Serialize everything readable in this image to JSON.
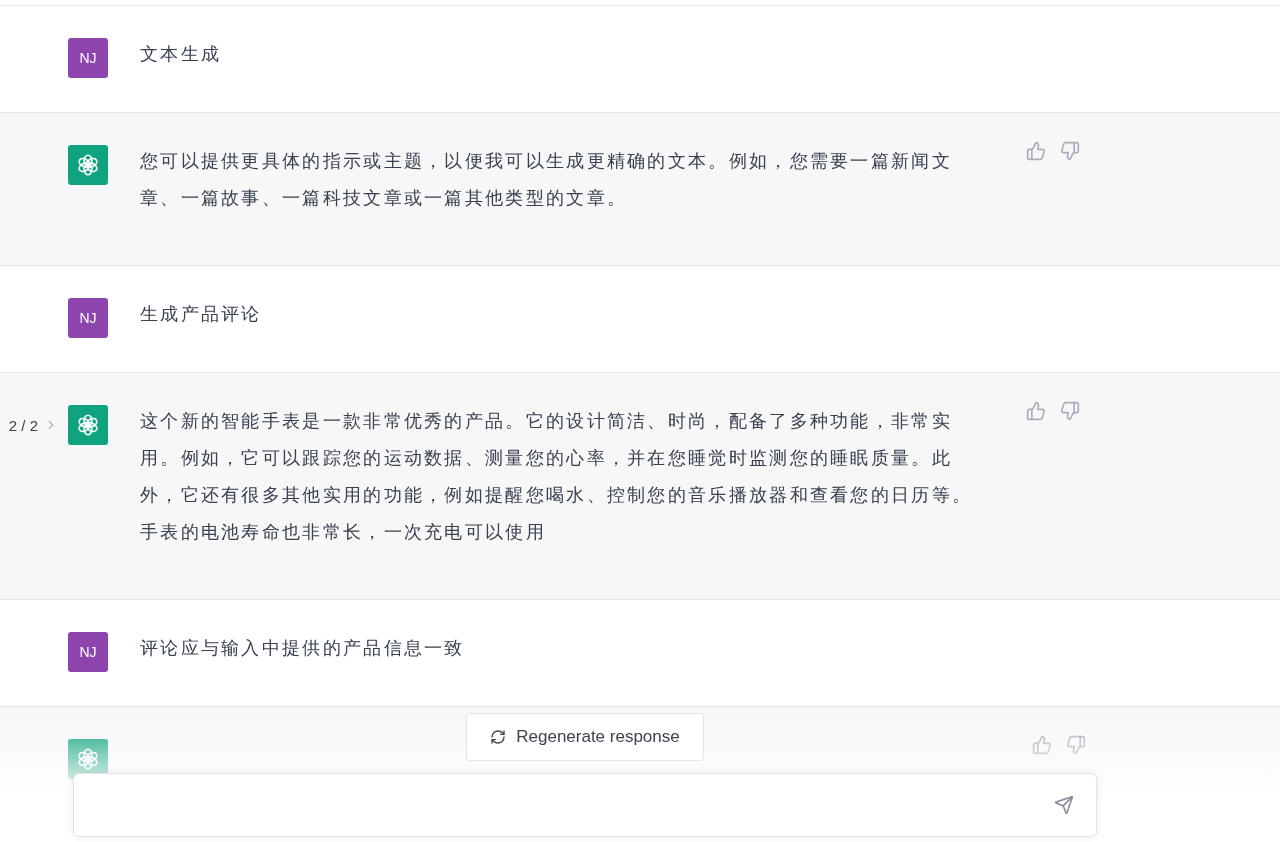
{
  "messages": [
    {
      "kind": "user",
      "avatar": "NJ",
      "text": "文本生成"
    },
    {
      "kind": "assistant",
      "text": "您可以提供更具体的指示或主题，以便我可以生成更精确的文本。例如，您需要一篇新闻文章、一篇故事、一篇科技文章或一篇其他类型的文章。"
    },
    {
      "kind": "user",
      "avatar": "NJ",
      "text": "生成产品评论"
    },
    {
      "kind": "assistant",
      "pager": "2 / 2",
      "text": "这个新的智能手表是一款非常优秀的产品。它的设计简洁、时尚，配备了多种功能，非常实用。例如，它可以跟踪您的运动数据、测量您的心率，并在您睡觉时监测您的睡眠质量。此外，它还有很多其他实用的功能，例如提醒您喝水、控制您的音乐播放器和查看您的日历等。手表的电池寿命也非常长，一次充电可以使用"
    },
    {
      "kind": "user",
      "avatar": "NJ",
      "text": "评论应与输入中提供的产品信息一致"
    },
    {
      "kind": "assistant"
    }
  ],
  "regenerate": {
    "label": "Regenerate response"
  }
}
